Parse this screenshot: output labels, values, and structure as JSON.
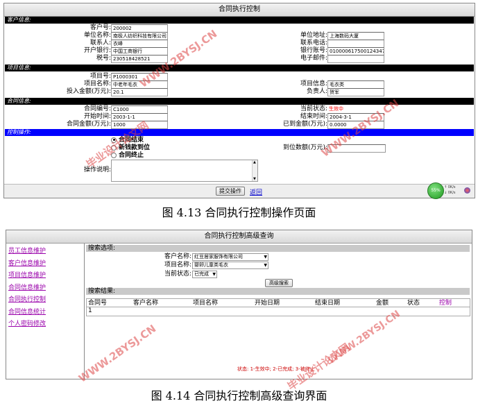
{
  "screen1": {
    "title": "合同执行控制",
    "customer_section": "客户信息:",
    "project_section": "项目信息:",
    "contract_section": "合同信息:",
    "operation_section": "控制操作:",
    "fields": {
      "customer_no_label": "客户号:",
      "customer_no": "200002",
      "company_label": "单位名称:",
      "company": "南极人纺织科技有限公司",
      "address_label": "单位地址:",
      "address": "上海数码大厦",
      "contact_label": "联系人:",
      "contact": "衣峰",
      "phone_label": "联系电话:",
      "phone": "",
      "bank_label": "开户银行:",
      "bank": "中国工商银行",
      "account_label": "银行账号:",
      "account": "0100006175001243471",
      "tax_label": "税号:",
      "tax": "230518428521",
      "email_label": "电子邮件:",
      "email": "",
      "project_no_label": "项目号:",
      "project_no": "P1000301",
      "project_name_label": "项目名称:",
      "project_name": "中老年毛衣",
      "project_info_label": "项目信息:",
      "project_info": "毛衣类",
      "invest_label": "投入金额(万元):",
      "invest": "20.1",
      "manager_label": "负责人:",
      "manager": "贺军",
      "contract_no_label": "合同编号:",
      "contract_no": "C1000",
      "status_label": "当前状态:",
      "status": "生效中",
      "start_label": "开始时间:",
      "start": "2003-1-1",
      "end_label": "结束时间:",
      "end": "2004-3-1",
      "amount_label": "合同金额(万元):",
      "amount": "1000",
      "arrived_label": "已到金额(万元):",
      "arrived": "0.0000",
      "arrive_amount_label": "到位数额(万元):",
      "arrive_amount": "",
      "op_desc_label": "操作说明:"
    },
    "radios": [
      "合同结束",
      "新钱款到位",
      "合同终止"
    ],
    "submit": "提交操作",
    "back": "返回",
    "tray_percent": "55%",
    "tray_speed_1": "0K/s",
    "tray_speed_2": "0K/s",
    "status_color": "#ff0000"
  },
  "caption1": "图 4.13  合同执行控制操作页面",
  "screen2": {
    "title": "合同执行控制高级查询",
    "nav": [
      "员工信息维护",
      "客户信息维护",
      "项目信息维护",
      "合同信息维护",
      "合同执行控制",
      "合同信息统计",
      "个人密码修改"
    ],
    "search_head": "搜索选项:",
    "customer_label": "客户名称:",
    "customer_value": "红豆居家服饰有限公司",
    "project_label": "项目名称:",
    "project_value": "婴卵儿童类毛衣",
    "status_label": "当前状态:",
    "status_value": "已完成",
    "search_button": "高级搜索",
    "result_head": "搜索结果:",
    "columns": [
      "合同号",
      "客户名称",
      "项目名称",
      "开始日期",
      "结束日期",
      "金额",
      "状态",
      "控制"
    ],
    "row": [
      "1"
    ],
    "legend": "状态: 1-生效中; 2-已完成; 3-被终止"
  },
  "caption2": "图 4.14  合同执行控制高级查询界面",
  "watermarks": [
    "毕业设计论文网",
    "WWW.2BYSJ.CN"
  ]
}
